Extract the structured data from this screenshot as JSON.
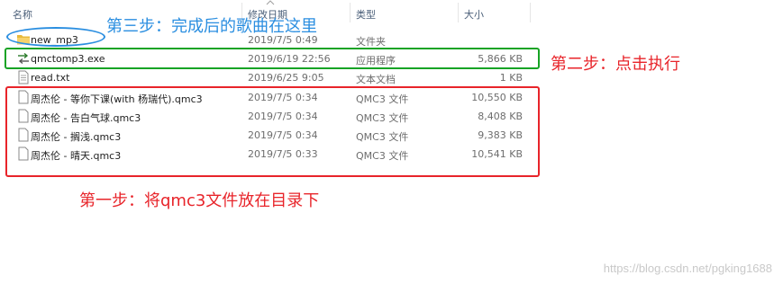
{
  "columns": {
    "name": "名称",
    "date": "修改日期",
    "type": "类型",
    "size": "大小"
  },
  "files": [
    {
      "name": "new_mp3",
      "date": "2019/7/5 0:49",
      "type": "文件夹",
      "size": "",
      "icon": "folder-icon"
    },
    {
      "name": "qmctomp3.exe",
      "date": "2019/6/19 22:56",
      "type": "应用程序",
      "size": "5,866 KB",
      "icon": "executable-icon"
    },
    {
      "name": "read.txt",
      "date": "2019/6/25 9:05",
      "type": "文本文档",
      "size": "1 KB",
      "icon": "text-file-icon"
    },
    {
      "name": "周杰伦 - 等你下课(with 杨瑞代).qmc3",
      "date": "2019/7/5 0:34",
      "type": "QMC3 文件",
      "size": "10,550 KB",
      "icon": "file-icon"
    },
    {
      "name": "周杰伦 - 告白气球.qmc3",
      "date": "2019/7/5 0:34",
      "type": "QMC3 文件",
      "size": "8,408 KB",
      "icon": "file-icon"
    },
    {
      "name": "周杰伦 - 搁浅.qmc3",
      "date": "2019/7/5 0:34",
      "type": "QMC3 文件",
      "size": "9,383 KB",
      "icon": "file-icon"
    },
    {
      "name": "周杰伦 - 晴天.qmc3",
      "date": "2019/7/5 0:33",
      "type": "QMC3 文件",
      "size": "10,541 KB",
      "icon": "file-icon"
    }
  ],
  "annotations": {
    "step1": "第一步：将qmc3文件放在目录下",
    "step2": "第二步：点击执行",
    "step3": "第三步：完成后的歌曲在这里"
  },
  "colors": {
    "step1": "#e8242a",
    "step2": "#17a325",
    "step3": "#2a8ee0"
  },
  "watermark": "https://blog.csdn.net/pgking1688"
}
